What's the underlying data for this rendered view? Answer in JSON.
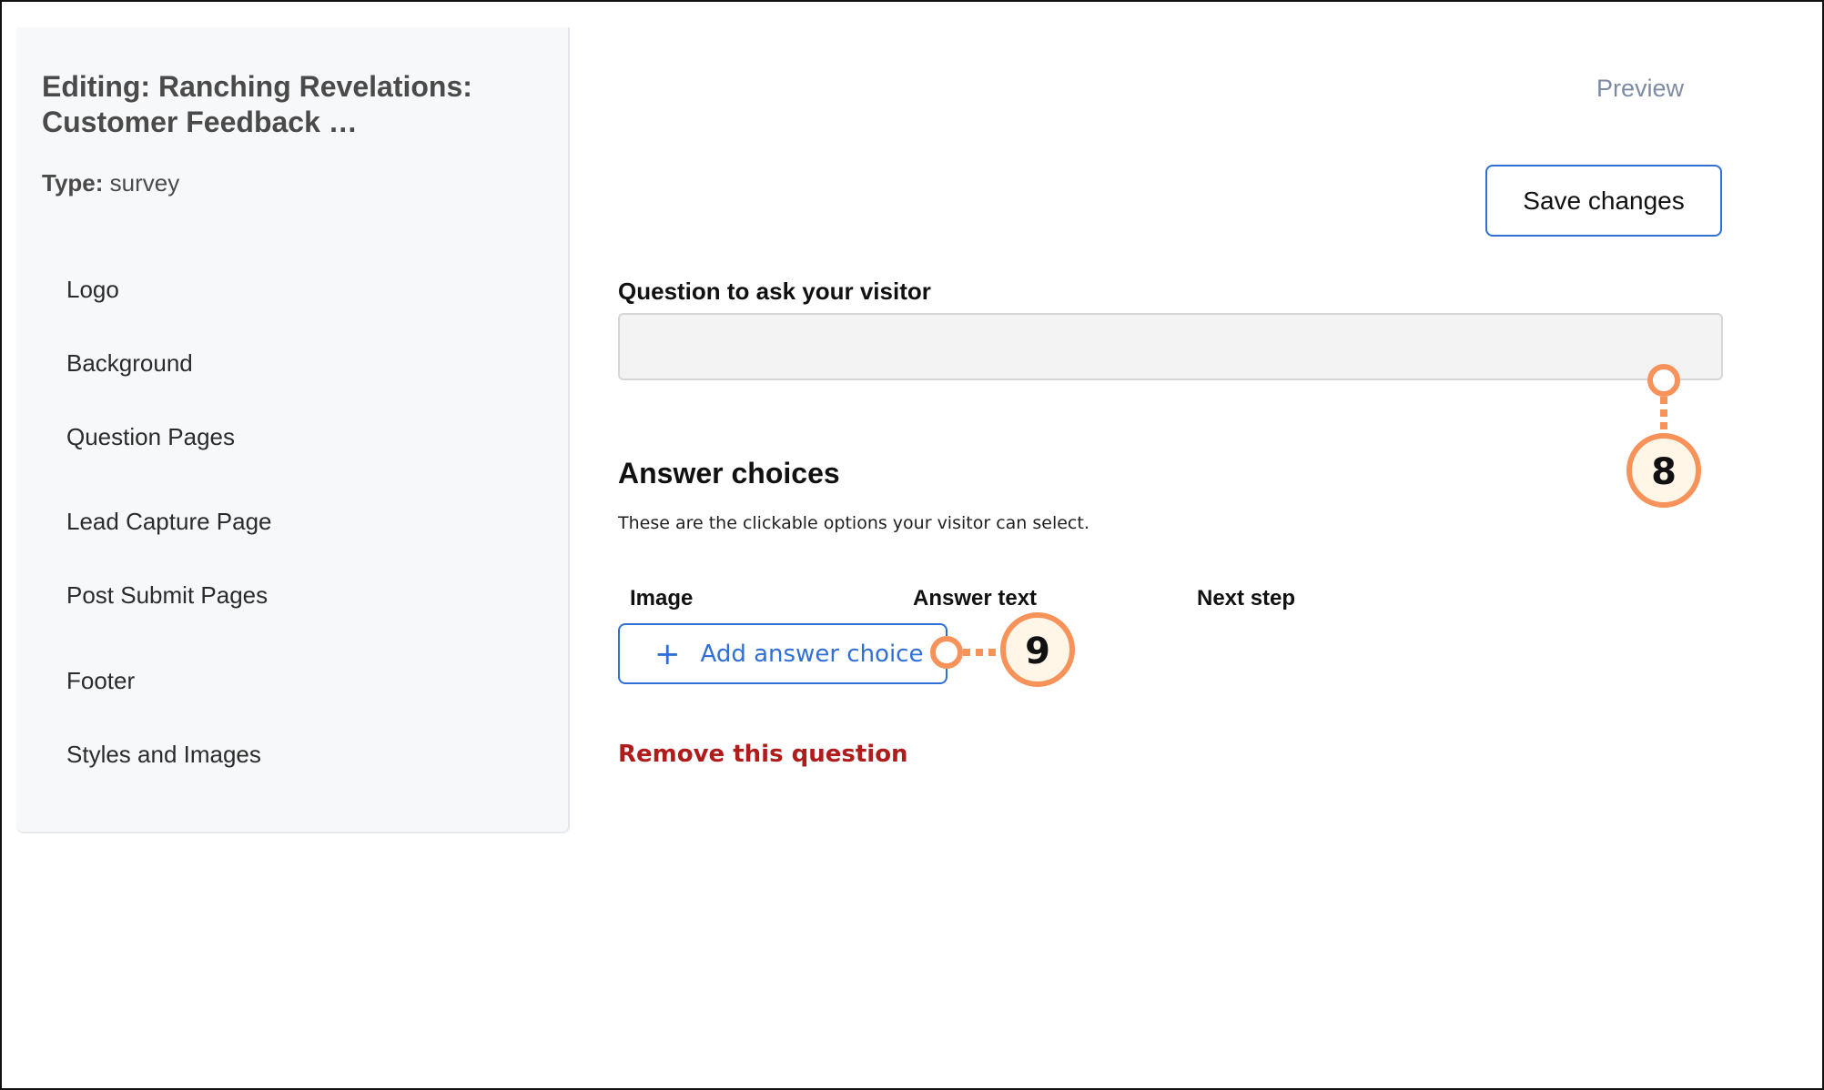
{
  "sidebar": {
    "title": "Editing: Ranching Revelations: Customer Feedback …",
    "type_label": "Type:",
    "type_value": "survey",
    "items": [
      {
        "label": "Logo"
      },
      {
        "label": "Background"
      },
      {
        "label": "Question Pages"
      },
      {
        "label": "Lead Capture Page"
      },
      {
        "label": "Post Submit Pages"
      },
      {
        "label": "Footer"
      },
      {
        "label": "Styles and Images"
      }
    ]
  },
  "header": {
    "preview_label": "Preview",
    "save_label": "Save changes"
  },
  "question": {
    "label": "Question to ask your visitor",
    "value": "",
    "placeholder": ""
  },
  "answers": {
    "title": "Answer choices",
    "description": "These are the clickable options your visitor can select.",
    "columns": [
      "Image",
      "Answer text",
      "Next step"
    ],
    "add_label": "Add answer choice",
    "add_icon": "plus-icon"
  },
  "remove_label": "Remove this question",
  "callouts": [
    {
      "number": "8"
    },
    {
      "number": "9"
    }
  ],
  "colors": {
    "accent": "#2f6fd6",
    "danger": "#b01c1c",
    "callout": "#f7935a",
    "callout_fill": "#fff6e8"
  }
}
